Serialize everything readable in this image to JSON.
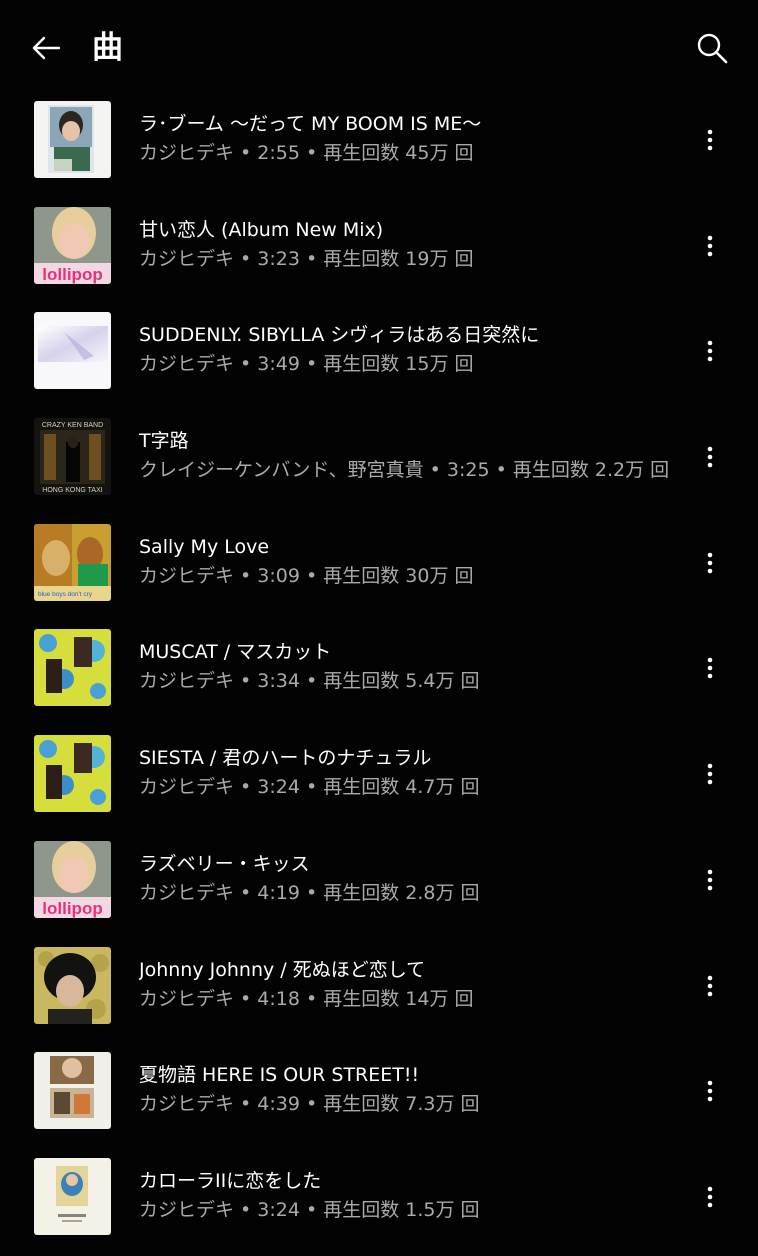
{
  "header": {
    "title": "曲",
    "back_icon": "arrow-left-icon",
    "search_icon": "search-icon"
  },
  "songs": [
    {
      "title": "ラ･ブーム 〜だって MY BOOM IS ME〜",
      "subtitle": "カジヒデキ • 2:55 • 再生回数 45万 回"
    },
    {
      "title": "甘い恋人 (Album New Mix)",
      "subtitle": "カジヒデキ • 3:23 • 再生回数 19万 回"
    },
    {
      "title": "SUDDENLY. SIBYLLA シヴィラはある日突然に",
      "subtitle": "カジヒデキ • 3:49 • 再生回数 15万 回"
    },
    {
      "title": "T字路",
      "subtitle": "クレイジーケンバンド、野宮真貴 • 3:25 • 再生回数 2.2万 回"
    },
    {
      "title": "Sally My Love",
      "subtitle": "カジヒデキ • 3:09 • 再生回数 30万 回"
    },
    {
      "title": "MUSCAT / マスカット",
      "subtitle": "カジヒデキ • 3:34 • 再生回数 5.4万 回"
    },
    {
      "title": "SIESTA / 君のハートのナチュラル",
      "subtitle": "カジヒデキ • 3:24 • 再生回数 4.7万 回"
    },
    {
      "title": "ラズベリー・キッス",
      "subtitle": "カジヒデキ • 4:19 • 再生回数 2.8万 回"
    },
    {
      "title": "Johnny Johnny / 死ぬほど恋して",
      "subtitle": "カジヒデキ • 4:18 • 再生回数 14万 回"
    },
    {
      "title": "夏物語 HERE IS OUR STREET!!",
      "subtitle": "カジヒデキ • 4:39 • 再生回数 7.3万 回"
    },
    {
      "title": "カローラIIに恋をした",
      "subtitle": "カジヒデキ • 3:24 • 再生回数 1.5万 回"
    }
  ],
  "thumb_labels": {
    "lollipop": "lollipop",
    "crazy_top": "CRAZY KEN BAND",
    "crazy_bottom": "HONG KONG TAXI",
    "blue": "blue boys don't cry"
  },
  "colors": {
    "background": "#030303",
    "primary_text": "#ffffff",
    "secondary_text": "#aaaaaa",
    "lollipop_pink": "#e8317c"
  }
}
